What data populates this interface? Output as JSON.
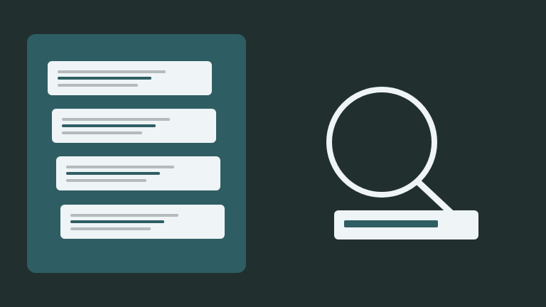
{
  "colors": {
    "background": "#21302f",
    "panel": "#2e5e63",
    "card": "#eff4f6",
    "line_gray": "#b3bbbd",
    "line_teal": "#2e5e63",
    "icon_stroke": "#eff4f6",
    "search_fill": "#2e5e63"
  },
  "results_list": {
    "cards": [
      {
        "icon": "result-card"
      },
      {
        "icon": "result-card"
      },
      {
        "icon": "result-card"
      },
      {
        "icon": "result-card"
      }
    ]
  },
  "search": {
    "icon": "magnifying-glass-icon",
    "query_fill": 0.65
  }
}
